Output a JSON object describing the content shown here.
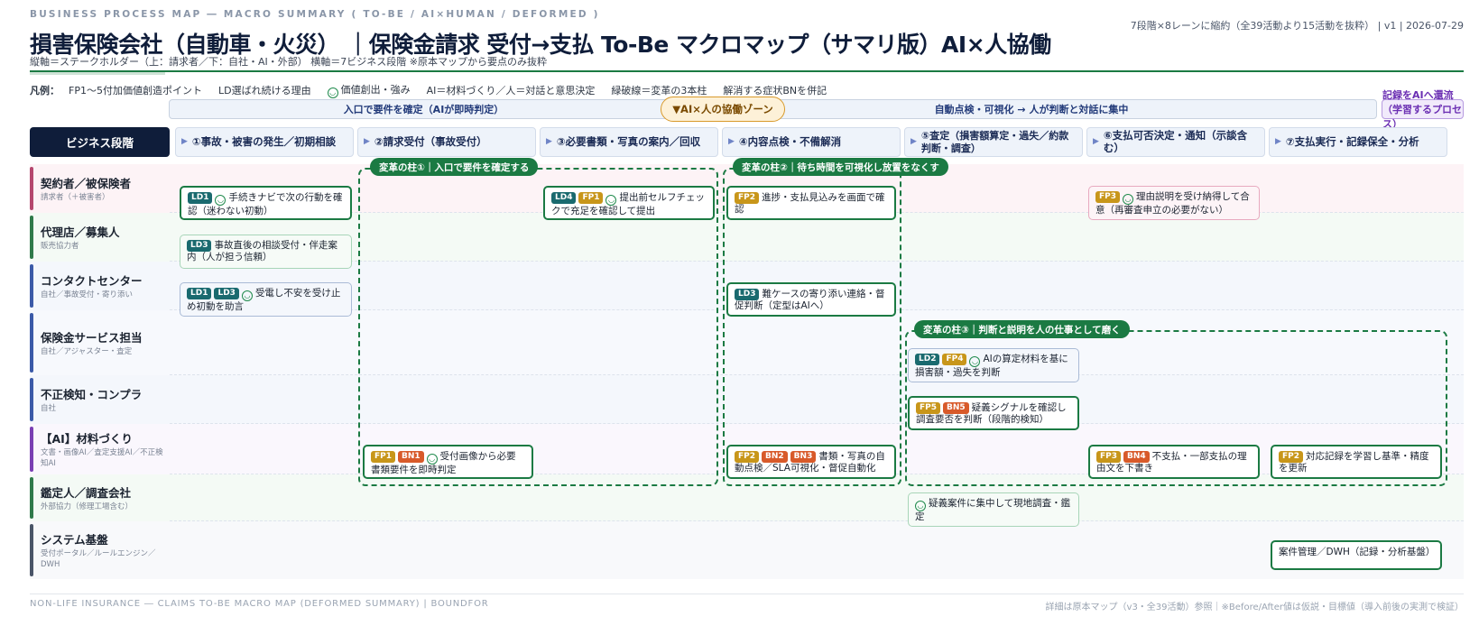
{
  "header": {
    "eyebrow": "BUSINESS PROCESS MAP ― MACRO SUMMARY ( TO-BE / AI×HUMAN / DEFORMED )",
    "meta": "7段階×8レーンに縮約（全39活動より15活動を抜粋） | v1 | 2026-07-29",
    "title": "損害保険会社（自動車・火災） ｜保険金請求 受付→支払 To-Be マクロマップ（サマリ版）AI×人協働",
    "subtitle": "縦軸＝ステークホルダー（上：請求者／下：自社・AI・外部） 横軸＝7ビジネス段階 ※原本マップから要点のみ抜粋"
  },
  "legend": {
    "title": "凡例：",
    "items": [
      "FP1〜5付加価値創造ポイント",
      "LD選ばれ続ける理由",
      "価値創出・強み",
      "AI＝材料づくり／人＝対話と意思決定",
      "緑破線＝変革の3本柱",
      "解消する症状BNを併記"
    ]
  },
  "zones": {
    "left": "入口で要件を確定（AIが即時判定）",
    "center": "▼AI×人の協働ゾーン",
    "right": "自動点検・可視化 → 人が判断と対話に集中",
    "purple": "記録をAIへ還流（学習するプロセス）"
  },
  "stage_label": "ビジネス段階",
  "stages": [
    "①事故・被害の発生／初期相談",
    "②請求受付（事故受付）",
    "③必要書類・写真の案内／回収",
    "④内容点検・不備解消",
    "⑤査定（損害額算定・過失／約款判断・調査）",
    "⑥支払可否決定・通知（示談含む）",
    "⑦支払実行・記録保全・分析"
  ],
  "lanes": [
    {
      "name": "契約者／被保険者",
      "sub": "請求者（＋被害者）",
      "color": "#b5476e"
    },
    {
      "name": "代理店／募集人",
      "sub": "販売協力者",
      "color": "#2f7a4a"
    },
    {
      "name": "コンタクトセンター",
      "sub": "自社／事故受付・寄り添い",
      "color": "#3b5aa8"
    },
    {
      "name": "保険金サービス担当",
      "sub": "自社／アジャスター・査定",
      "color": "#3b5aa8"
    },
    {
      "name": "不正検知・コンプラ",
      "sub": "自社",
      "color": "#3b5aa8"
    },
    {
      "name": "【AI】材料づくり",
      "sub": "文書・画像AI／査定支援AI／不正検知AI",
      "color": "#7a3fb3"
    },
    {
      "name": "鑑定人／調査会社",
      "sub": "外部協力（修理工場含む）",
      "color": "#2f7a4a"
    },
    {
      "name": "システム基盤",
      "sub": "受付ポータル／ルールエンジン／DWH",
      "color": "#4a5568"
    }
  ],
  "pillars": {
    "p1": "変革の柱①｜入口で要件を確定する",
    "p2": "変革の柱②｜待ち時間を可視化し放置をなくす",
    "p3": "変革の柱③｜判断と説明を人の仕事として磨く"
  },
  "cards": {
    "c1": {
      "tags": [
        "LD1"
      ],
      "smile": true,
      "text": "手続きナビで次の行動を確認（迷わない初動）"
    },
    "c2": {
      "tags": [
        "LD4",
        "FP1"
      ],
      "smile": true,
      "text": "提出前セルフチェックで充足を確認して提出"
    },
    "c3": {
      "tags": [
        "FP2"
      ],
      "smile": false,
      "text": "進捗・支払見込みを画面で確認"
    },
    "c4": {
      "tags": [
        "FP3"
      ],
      "smile": true,
      "text": "理由説明を受け納得して合意（再審査申立の必要がない）"
    },
    "c5": {
      "tags": [
        "LD3"
      ],
      "smile": false,
      "text": "事故直後の相談受付・伴走案内（人が担う信頼）"
    },
    "c6": {
      "tags": [
        "LD1",
        "LD3"
      ],
      "smile": true,
      "text": "受電し不安を受け止め初動を助言"
    },
    "c7": {
      "tags": [
        "LD3"
      ],
      "smile": false,
      "text": "難ケースの寄り添い連絡・督促判断（定型はAIへ）"
    },
    "c8": {
      "tags": [
        "LD2",
        "FP4"
      ],
      "smile": true,
      "text": "AIの算定材料を基に損害額・過失を判断"
    },
    "c9": {
      "tags": [
        "FP5",
        "BN5"
      ],
      "smile": false,
      "text": "疑義シグナルを確認し調査要否を判断（段階的検知）"
    },
    "c10": {
      "tags": [
        "FP1",
        "BN1"
      ],
      "smile": true,
      "text": "受付画像から必要書類要件を即時判定"
    },
    "c11": {
      "tags": [
        "FP2",
        "BN2",
        "BN3"
      ],
      "smile": false,
      "text": "書類・写真の自動点検／SLA可視化・督促自動化"
    },
    "c12": {
      "tags": [
        "FP3",
        "BN4"
      ],
      "smile": false,
      "text": "不支払・一部支払の理由文を下書き"
    },
    "c13": {
      "tags": [
        "FP2"
      ],
      "smile": false,
      "text": "対応記録を学習し基準・精度を更新"
    },
    "c14": {
      "tags": [],
      "smile": true,
      "text": "疑義案件に集中して現地調査・鑑定"
    },
    "c15": {
      "tags": [],
      "smile": false,
      "text": "案件管理／DWH（記録・分析基盤）"
    }
  },
  "footer": {
    "left": "NON-LIFE INSURANCE ― CLAIMS TO-BE MACRO MAP (DEFORMED SUMMARY) | BOUNDFOR",
    "right": "詳細は原本マップ（v3・全39活動）参照｜※Before/After値は仮説・目標値（導入前後の実測で検証）"
  }
}
